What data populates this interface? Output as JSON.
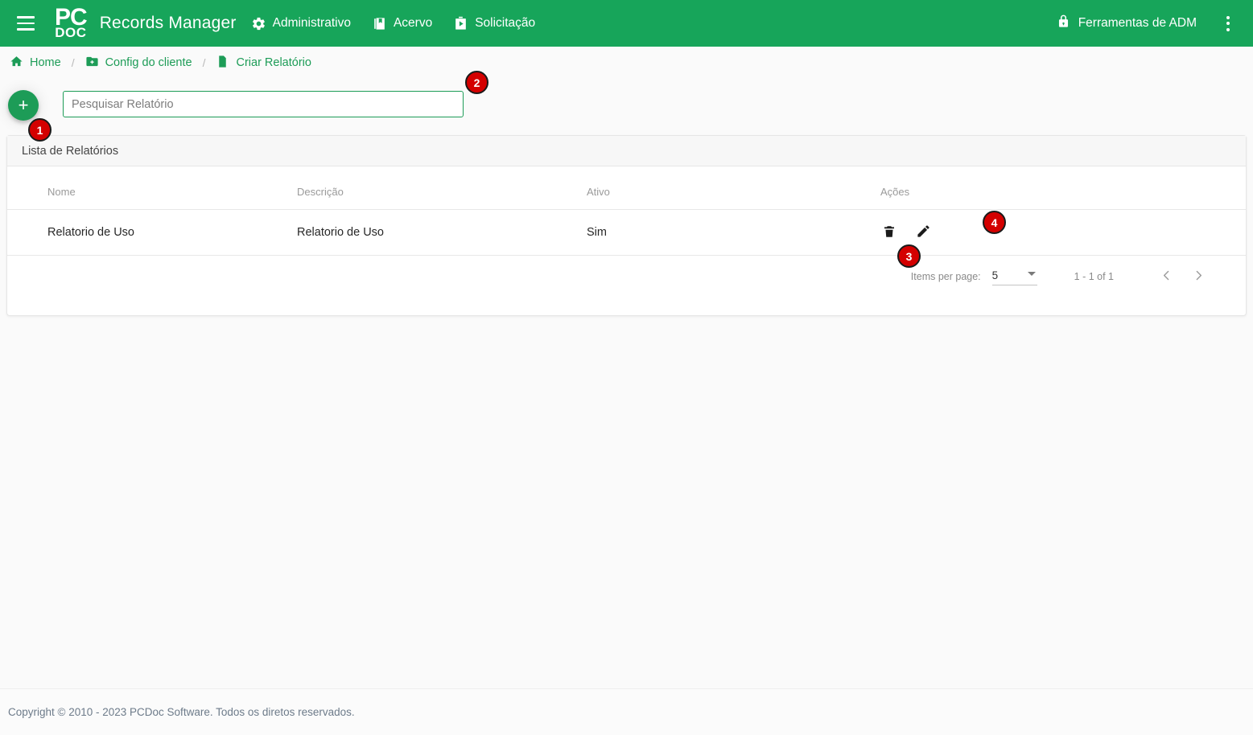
{
  "header": {
    "menu_icon": "hamburger-menu-icon",
    "logo_line1": "PC",
    "logo_line2": "DOC",
    "app_title": "Records Manager",
    "nav": [
      {
        "label": "Administrativo",
        "icon": "gear-icon"
      },
      {
        "label": "Acervo",
        "icon": "library-book-icon"
      },
      {
        "label": "Solicitação",
        "icon": "video-box-icon"
      }
    ],
    "adm_tools": {
      "label": "Ferramentas de ADM",
      "icon": "lock-icon"
    },
    "kebab_icon": "more-vertical-icon",
    "background_color": "#17a55a"
  },
  "breadcrumb": {
    "items": [
      {
        "label": "Home",
        "icon": "home-icon"
      },
      {
        "label": "Config do cliente",
        "icon": "folder-plus-icon"
      },
      {
        "label": "Criar Relatório",
        "icon": "document-icon"
      }
    ],
    "separator": "/",
    "link_color": "#1d9c57"
  },
  "toolbar": {
    "add_button_label": "+",
    "add_button_icon": "plus-icon",
    "search_placeholder": "Pesquisar Relatório",
    "search_value": ""
  },
  "card": {
    "title": "Lista de Relatórios"
  },
  "table": {
    "columns": [
      "Nome",
      "Descrição",
      "Ativo",
      "Ações"
    ],
    "rows": [
      {
        "nome": "Relatorio de Uso",
        "descricao": "Relatorio de Uso",
        "ativo": "Sim",
        "actions": [
          {
            "name": "delete-button",
            "icon": "trash-icon"
          },
          {
            "name": "edit-button",
            "icon": "pencil-icon"
          }
        ]
      }
    ]
  },
  "paginator": {
    "items_per_page_label": "Items per page:",
    "items_per_page_value": "5",
    "range_label": "1 - 1 of 1",
    "prev_icon": "chevron-left-icon",
    "next_icon": "chevron-right-icon"
  },
  "badges": [
    {
      "id": 1,
      "label": "1"
    },
    {
      "id": 2,
      "label": "2"
    },
    {
      "id": 3,
      "label": "3"
    },
    {
      "id": 4,
      "label": "4"
    }
  ],
  "footer": {
    "copyright": "Copyright © 2010 - 2023 PCDoc Software. Todos os diretos reservados."
  }
}
